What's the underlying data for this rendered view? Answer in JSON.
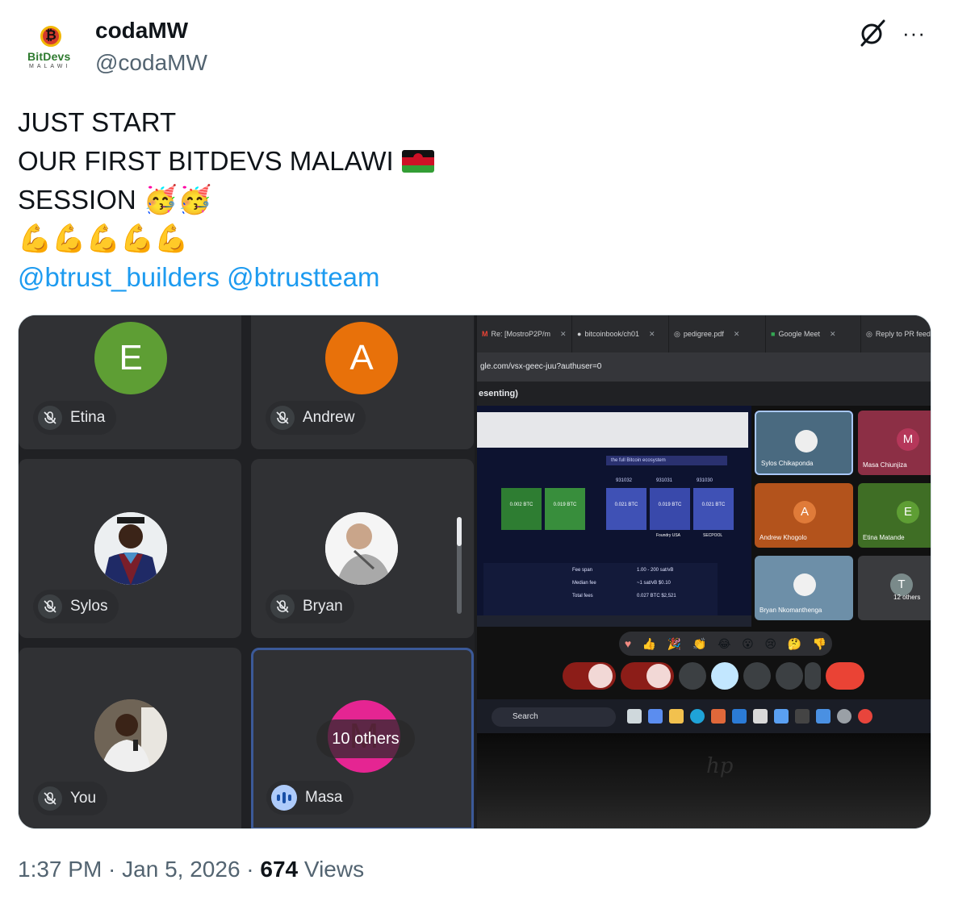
{
  "author": {
    "display_name": "codaMW",
    "handle": "@codaMW",
    "avatar_wordmark": "BitDevs",
    "avatar_subtext": "MALAWI"
  },
  "actions": {
    "grok_icon": "grok-icon",
    "more_label": "···"
  },
  "tweet": {
    "line1": "JUST START",
    "line2": "OUR FIRST BITDEVS MALAWI",
    "line3": "SESSION",
    "line3_emoji": "🥳🥳",
    "line4_emoji": "💪💪💪💪💪",
    "mention1": "@btrust_builders",
    "mention2": "@btrustteam",
    "flag_colors": [
      "#111111",
      "#ce1126",
      "#339e35"
    ],
    "accent": "#1d9bf0"
  },
  "meet_grid": {
    "tiles": [
      {
        "name": "Etina",
        "avatar_letter": "E",
        "avatar_color": "#5e9e34"
      },
      {
        "name": "Andrew",
        "avatar_letter": "A",
        "avatar_color": "#e8710a"
      },
      {
        "name": "Sylos"
      },
      {
        "name": "Bryan"
      },
      {
        "name": "You"
      },
      {
        "name": "Masa",
        "avatar_letter": "M",
        "avatar_color": "#e52592",
        "others_label": "10 others"
      }
    ]
  },
  "photo": {
    "tabs": [
      "Re: [MostroP2P/m",
      "bitcoinbook/ch01",
      "pedigree.pdf",
      "Google Meet",
      "Reply to PR feedb"
    ],
    "url_fragment": "gle.com/vsx-geec-juu?authuser=0",
    "presenting_label": "esenting)",
    "screen_search": "the full Bitcoin ecosystem",
    "block_numbers": [
      "931032",
      "931031",
      "931030"
    ],
    "blocks": [
      "0.002 BTC",
      "0.019 BTC",
      "0.021 BTC",
      "0.019 BTC",
      "0.021 BTC"
    ],
    "miners": [
      "Foundry USA",
      "SECPOOL"
    ],
    "fee_rows": [
      {
        "label": "Fee span",
        "value": "1.00 - 200 sat/vB"
      },
      {
        "label": "Median fee",
        "value": "~1 sat/vB $0.10"
      },
      {
        "label": "Total fees",
        "value": "0.027 BTC $2,521"
      }
    ],
    "participants": [
      {
        "name": "Sylos Chikaponda"
      },
      {
        "name": "Masa Chiunjiza",
        "letter": "M",
        "color": "#b5375a"
      },
      {
        "name": "Andrew Khogolo",
        "letter": "A",
        "color": "#d8641f"
      },
      {
        "name": "Etina Matande",
        "letter": "E",
        "color": "#4b8a2a"
      },
      {
        "name": "Bryan Nkomanthenga"
      },
      {
        "name": "12 others",
        "letter": "T"
      }
    ],
    "reactions": [
      "♥",
      "👍",
      "🎉",
      "👏",
      "😂",
      "😮",
      "😢",
      "🤔",
      "👎"
    ],
    "taskbar_search": "Search",
    "brand": "hp"
  },
  "footer": {
    "time": "1:37 PM",
    "separator": " · ",
    "date": "Jan 5, 2026",
    "views_count": "674",
    "views_label": " Views"
  }
}
